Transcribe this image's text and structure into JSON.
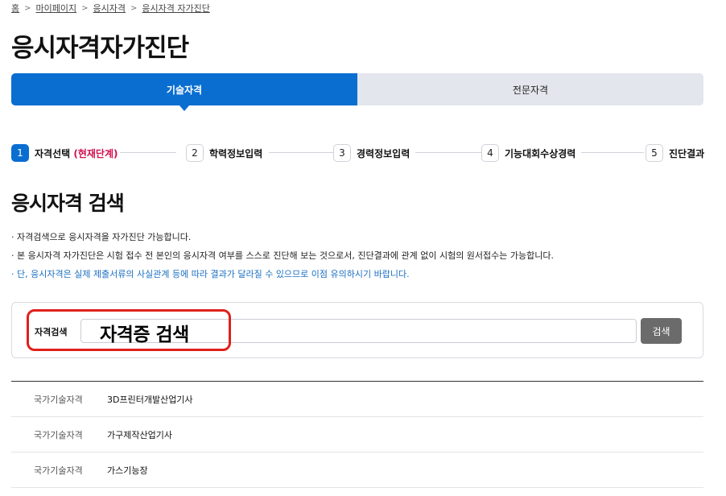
{
  "breadcrumb": [
    "홈",
    "마이페이지",
    "응시자격",
    "응시자격 자가진단"
  ],
  "page_title": "응시자격자가진단",
  "tabs": [
    {
      "label": "기술자격",
      "active": true
    },
    {
      "label": "전문자격",
      "active": false
    }
  ],
  "steps": [
    {
      "num": "1",
      "label": "자격선택",
      "note": "(현재단계)",
      "current": true
    },
    {
      "num": "2",
      "label": "학력정보입력",
      "current": false
    },
    {
      "num": "3",
      "label": "경력정보입력",
      "current": false
    },
    {
      "num": "4",
      "label": "기능대회수상경력",
      "current": false
    },
    {
      "num": "5",
      "label": "진단결과",
      "current": false
    }
  ],
  "section_title": "응시자격 검색",
  "notes": [
    "· 자격검색으로 응시자격을 자가진단 가능합니다.",
    "· 본 응시자격 자가진단은 시험 접수 전 본인의 응시자격 여부를 스스로 진단해 보는 것으로서, 진단결과에 관계 없이 시험의 원서접수는 가능합니다.",
    "· 단, 응시자격은 실제 제출서류의 사실관계 등에 따라 결과가 달라질 수 있으므로 이점 유의하시기 바랍니다."
  ],
  "search": {
    "label": "자격검색",
    "value": "",
    "button": "검색",
    "annotation": "자격증 검색"
  },
  "results": [
    {
      "category": "국가기술자격",
      "name": "3D프린터개발산업기사"
    },
    {
      "category": "국가기술자격",
      "name": "가구제작산업기사"
    },
    {
      "category": "국가기술자격",
      "name": "가스기능장"
    }
  ],
  "colors": {
    "primary": "#0a6ed1",
    "current_step_note": "#d0114e",
    "annotation_border": "#e0201b",
    "search_button": "#6b6b6b"
  }
}
